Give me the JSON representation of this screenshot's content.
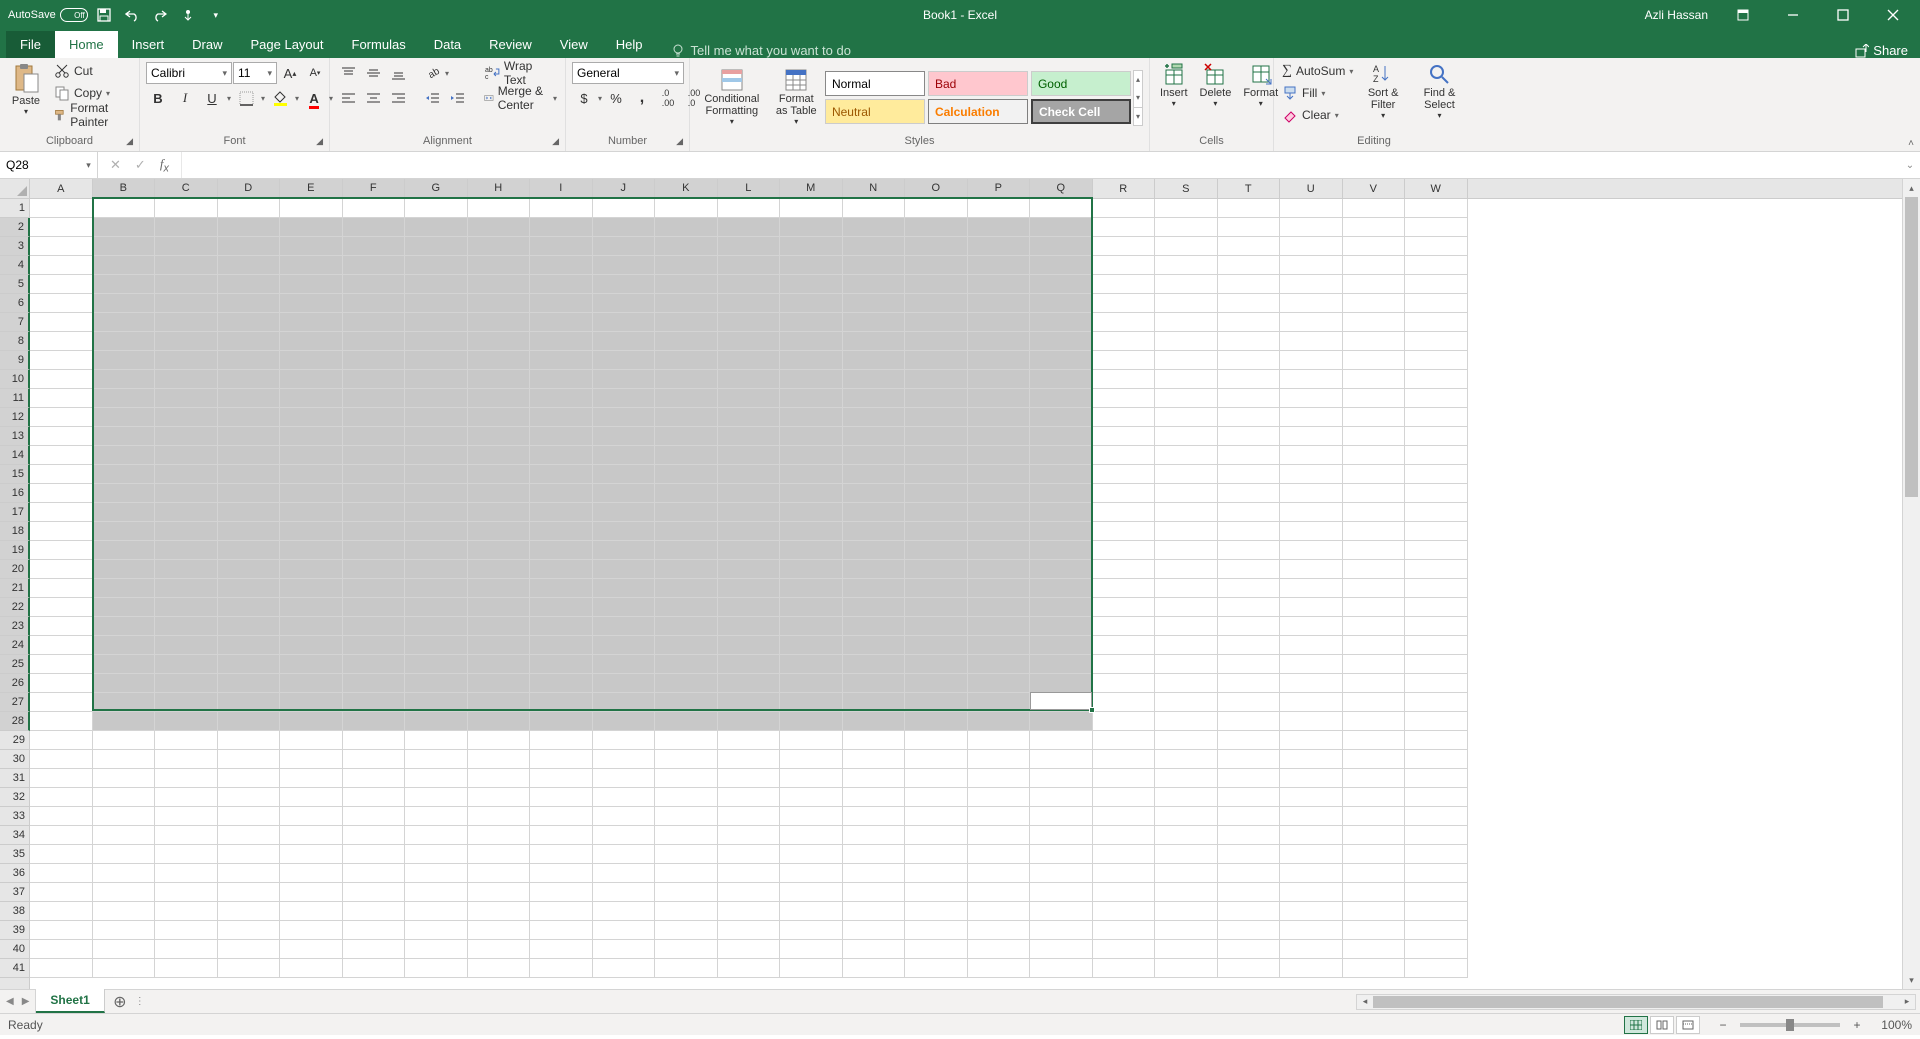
{
  "titlebar": {
    "autosave_label": "AutoSave",
    "autosave_state": "Off",
    "doc_title": "Book1 - Excel",
    "user": "Azli Hassan"
  },
  "tabs": {
    "file": "File",
    "list": [
      "Home",
      "Insert",
      "Draw",
      "Page Layout",
      "Formulas",
      "Data",
      "Review",
      "View",
      "Help"
    ],
    "active": "Home",
    "tellme": "Tell me what you want to do",
    "share": "Share"
  },
  "ribbon": {
    "clipboard": {
      "paste": "Paste",
      "cut": "Cut",
      "copy": "Copy",
      "format_painter": "Format Painter",
      "label": "Clipboard"
    },
    "font": {
      "name": "Calibri",
      "size": "11",
      "label": "Font"
    },
    "alignment": {
      "wrap": "Wrap Text",
      "merge": "Merge & Center",
      "label": "Alignment"
    },
    "number": {
      "format": "General",
      "label": "Number"
    },
    "styles": {
      "cond": "Conditional Formatting",
      "fat": "Format as Table",
      "normal": "Normal",
      "bad": "Bad",
      "good": "Good",
      "neutral": "Neutral",
      "calc": "Calculation",
      "check": "Check Cell",
      "label": "Styles"
    },
    "cells": {
      "insert": "Insert",
      "delete": "Delete",
      "format": "Format",
      "label": "Cells"
    },
    "editing": {
      "autosum": "AutoSum",
      "fill": "Fill",
      "clear": "Clear",
      "sort": "Sort & Filter",
      "find": "Find & Select",
      "label": "Editing"
    }
  },
  "formulabar": {
    "cellref": "Q28",
    "value": ""
  },
  "grid": {
    "cols": [
      "A",
      "B",
      "C",
      "D",
      "E",
      "F",
      "G",
      "H",
      "I",
      "J",
      "K",
      "L",
      "M",
      "N",
      "O",
      "P",
      "Q",
      "R",
      "S",
      "T",
      "U",
      "V",
      "W"
    ],
    "sel_cols_from": 1,
    "sel_cols_to": 16,
    "row_count": 41,
    "sel_rows_from": 2,
    "sel_rows_to": 28,
    "active_cell": "Q28"
  },
  "sheets": {
    "list": [
      "Sheet1"
    ],
    "active": "Sheet1"
  },
  "statusbar": {
    "mode": "Ready",
    "zoom": "100%"
  }
}
